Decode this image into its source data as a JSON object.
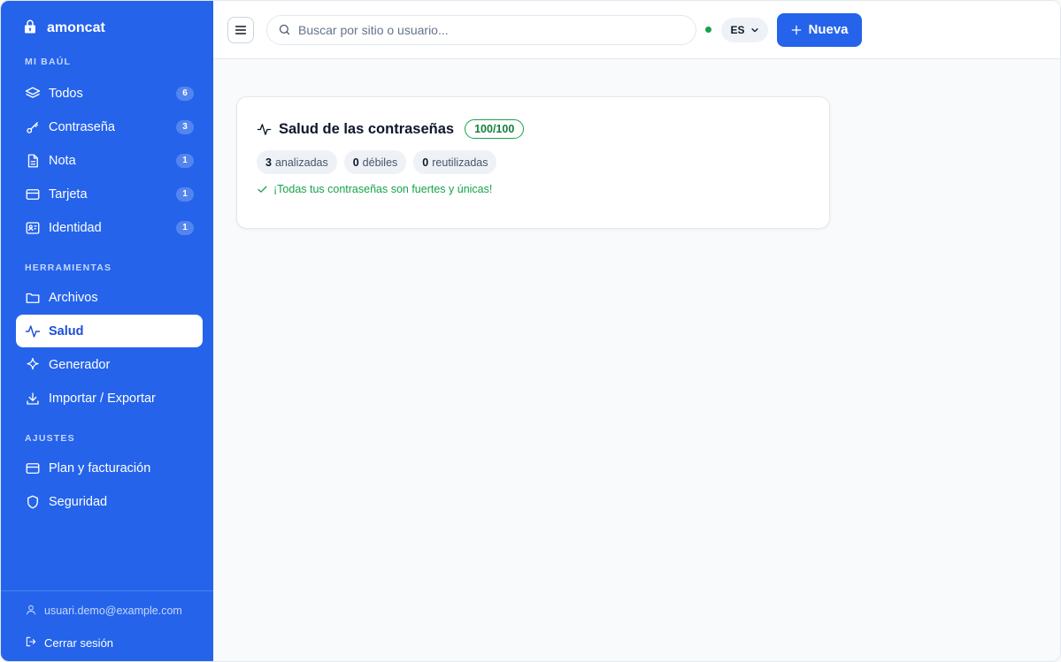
{
  "brand": {
    "name": "amoncat"
  },
  "sidebar": {
    "sections": [
      {
        "label": "MI BAÚL",
        "items": [
          {
            "label": "Todos",
            "count": "6",
            "icon": "layers-icon"
          },
          {
            "label": "Contraseña",
            "count": "3",
            "icon": "key-icon"
          },
          {
            "label": "Nota",
            "count": "1",
            "icon": "note-icon"
          },
          {
            "label": "Tarjeta",
            "count": "1",
            "icon": "card-icon"
          },
          {
            "label": "Identidad",
            "count": "1",
            "icon": "id-card-icon"
          }
        ]
      },
      {
        "label": "HERRAMIENTAS",
        "items": [
          {
            "label": "Archivos",
            "icon": "folder-icon"
          },
          {
            "label": "Salud",
            "icon": "activity-icon",
            "active": true
          },
          {
            "label": "Generador",
            "icon": "sparkle-icon"
          },
          {
            "label": "Importar / Exportar",
            "icon": "download-icon"
          }
        ]
      },
      {
        "label": "AJUSTES",
        "items": [
          {
            "label": "Plan y facturación",
            "icon": "card-icon"
          },
          {
            "label": "Seguridad",
            "icon": "shield-icon"
          }
        ]
      }
    ],
    "footer": {
      "email": "usuari.demo@example.com",
      "logout": "Cerrar sesión"
    }
  },
  "topbar": {
    "search_placeholder": "Buscar por sitio o usuario...",
    "language": "ES",
    "new_button": "Nueva"
  },
  "health": {
    "title": "Salud de las contraseñas",
    "score": "100/100",
    "chips": [
      {
        "value": "3",
        "label": "analizadas"
      },
      {
        "value": "0",
        "label": "débiles"
      },
      {
        "value": "0",
        "label": "reutilizadas"
      }
    ],
    "message": "¡Todas tus contraseñas son fuertes y únicas!"
  },
  "colors": {
    "sidebar": "#2563eb",
    "accent": "#2563eb",
    "success": "#16a34a"
  }
}
